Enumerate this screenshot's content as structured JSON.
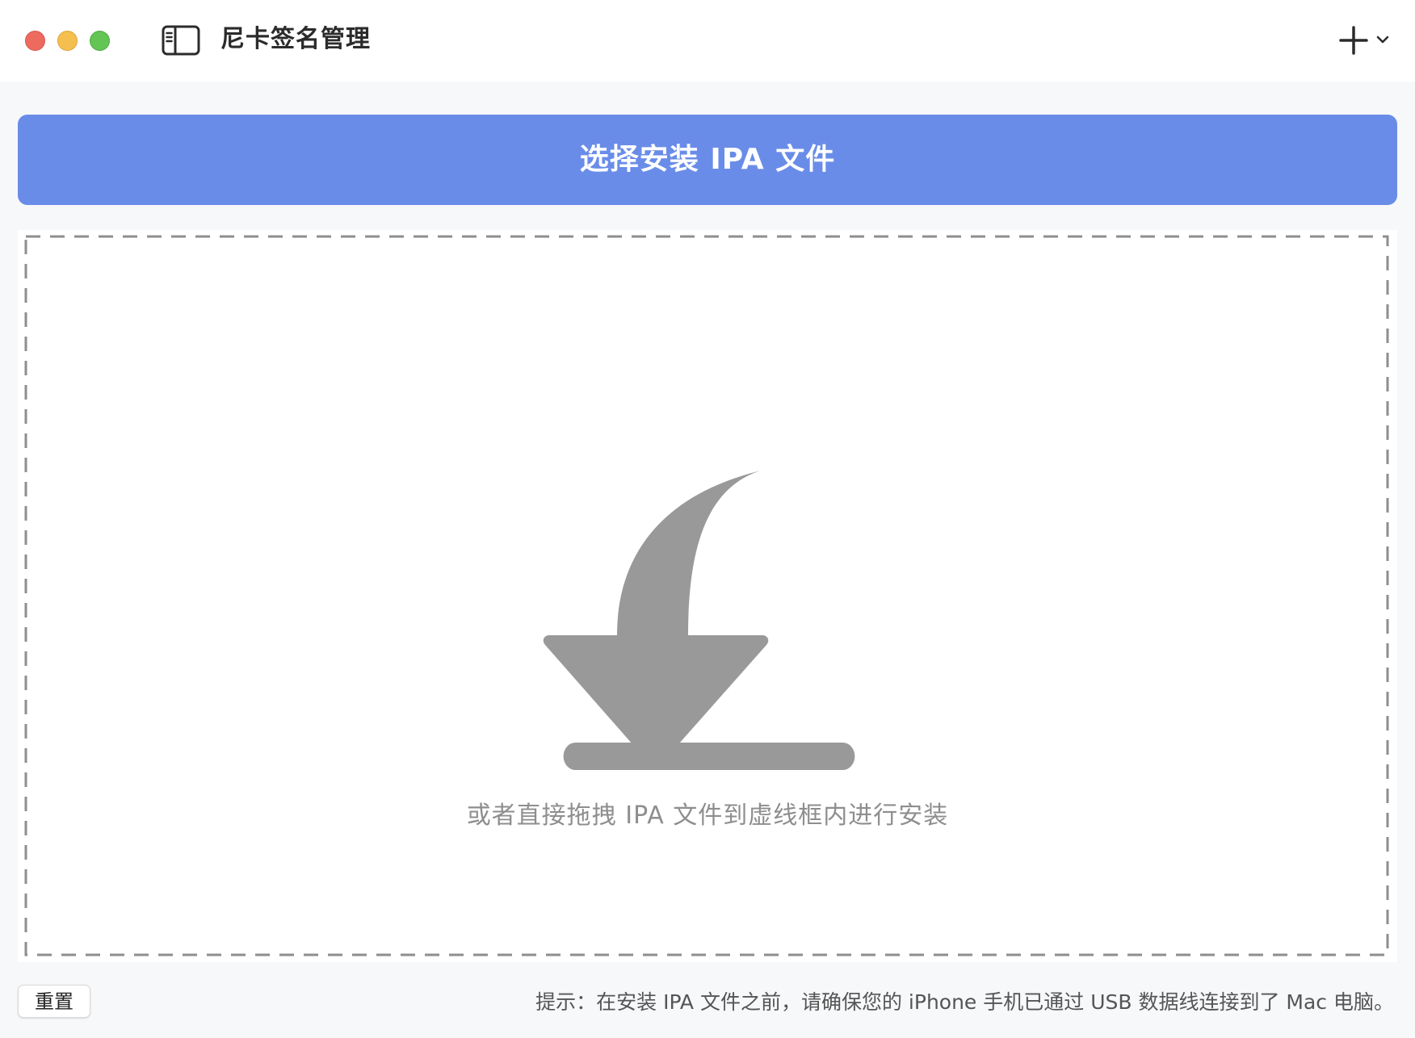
{
  "window": {
    "title": "尼卡签名管理"
  },
  "icons": {
    "sidebar_toggle": "sidebar-left-icon",
    "add": "plus-icon",
    "add_menu": "chevron-down-icon",
    "drop": "download-arrow-icon"
  },
  "main": {
    "select_button_label": "选择安装 IPA 文件",
    "drop_hint": "或者直接拖拽 IPA 文件到虚线框内进行安装"
  },
  "footer": {
    "reset_label": "重置",
    "tip": "提示：在安装 IPA 文件之前，请确保您的 iPhone 手机已通过 USB 数据线连接到了 Mac 电脑。"
  },
  "colors": {
    "accent": "#6a8ce9",
    "icon_gray": "#999999",
    "close": "#ed6a5e",
    "minimize": "#f5bf4f",
    "maximize": "#62c554"
  }
}
